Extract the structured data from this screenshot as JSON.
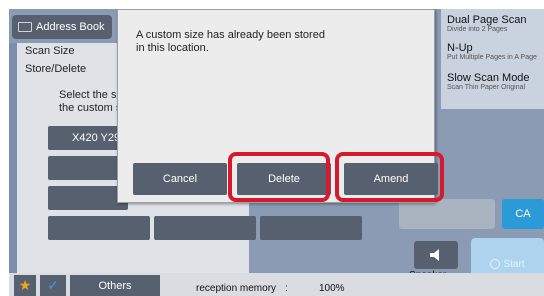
{
  "header": {
    "address_book_label": "Address Book"
  },
  "left_panel": {
    "scan_size_label": "Scan Size",
    "store_delete_label": "Store/Delete",
    "select_text_line1": "Select the s",
    "select_text_line2": "the custom s",
    "size_button_label": "X420 Y29"
  },
  "right_menu": {
    "items": [
      {
        "title": "Dual Page Scan",
        "subtitle": "Divide into 2 Pages"
      },
      {
        "title": "N-Up",
        "subtitle": "Put Multiple Pages in A Page"
      },
      {
        "title": "Slow Scan Mode",
        "subtitle": "Scan Thin Paper Original"
      }
    ]
  },
  "controls": {
    "ca_label": "CA",
    "speaker_label": "Speaker",
    "start_label": "Start"
  },
  "bottom_bar": {
    "star_glyph": "★",
    "check_glyph": "✓",
    "others_label": "Others",
    "reception_label": "reception memory",
    "reception_colon": ":",
    "reception_value": "100%"
  },
  "dialog": {
    "message_line1": "A custom size has already been stored",
    "message_line2": "in this location.",
    "cancel_label": "Cancel",
    "delete_label": "Delete",
    "amend_label": "Amend"
  },
  "colors": {
    "highlight": "#d7192e",
    "button_dark": "#56606e",
    "ca_blue": "#2a9bd6"
  },
  "icons": [
    "address-book-icon",
    "speaker-icon",
    "star-icon",
    "check-icon",
    "start-icon"
  ]
}
